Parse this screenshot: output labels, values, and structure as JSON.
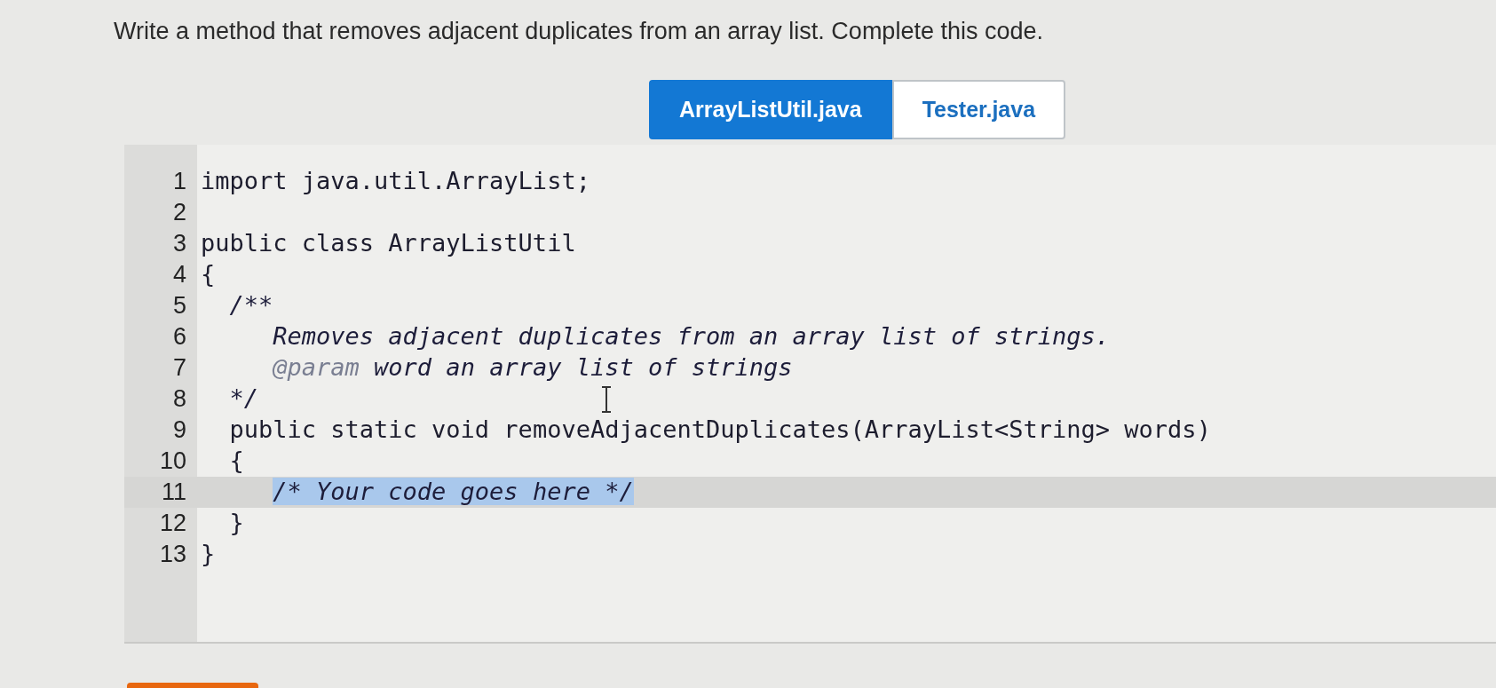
{
  "prompt": "Write a method that removes adjacent duplicates from an array list. Complete this code.",
  "tabs": [
    {
      "label": "ArrayListUtil.java",
      "selected": true
    },
    {
      "label": "Tester.java",
      "selected": false
    }
  ],
  "editor": {
    "lines": [
      {
        "number": "1",
        "highlighted": false,
        "segments": [
          {
            "kind": "code",
            "text": "import java.util.ArrayList;"
          }
        ]
      },
      {
        "number": "2",
        "highlighted": false
      },
      {
        "number": "3",
        "highlighted": false,
        "segments": [
          {
            "kind": "code",
            "text": "public class ArrayListUtil"
          }
        ]
      },
      {
        "number": "4",
        "highlighted": false,
        "segments": [
          {
            "kind": "code",
            "text": "{"
          }
        ]
      },
      {
        "number": "5",
        "highlighted": false,
        "segments": [
          {
            "kind": "comment",
            "text": "  /**"
          }
        ]
      },
      {
        "number": "6",
        "highlighted": false,
        "segments": [
          {
            "kind": "comment",
            "text": "     Removes adjacent duplicates from an array list of strings."
          }
        ]
      },
      {
        "number": "7",
        "highlighted": false,
        "segments": [
          {
            "kind": "doc-tag",
            "text": "     @param"
          },
          {
            "kind": "comment",
            "text": " word an array list of strings"
          }
        ]
      },
      {
        "number": "8",
        "highlighted": false,
        "segments": [
          {
            "kind": "comment",
            "text": "  */"
          }
        ]
      },
      {
        "number": "9",
        "highlighted": false,
        "segments": [
          {
            "kind": "code",
            "text": "  public static void removeAdjacentDuplicates(ArrayList<String> words)"
          }
        ]
      },
      {
        "number": "10",
        "highlighted": false,
        "segments": [
          {
            "kind": "code",
            "text": "  {"
          }
        ]
      },
      {
        "number": "11",
        "highlighted": true,
        "segments": [
          {
            "kind": "comment",
            "text": "     /* Your code goes here */",
            "selected": true
          }
        ]
      },
      {
        "number": "12",
        "highlighted": false,
        "segments": [
          {
            "kind": "code",
            "text": "  }"
          }
        ]
      },
      {
        "number": "13",
        "highlighted": false,
        "segments": [
          {
            "kind": "code",
            "text": "}"
          }
        ]
      }
    ]
  }
}
